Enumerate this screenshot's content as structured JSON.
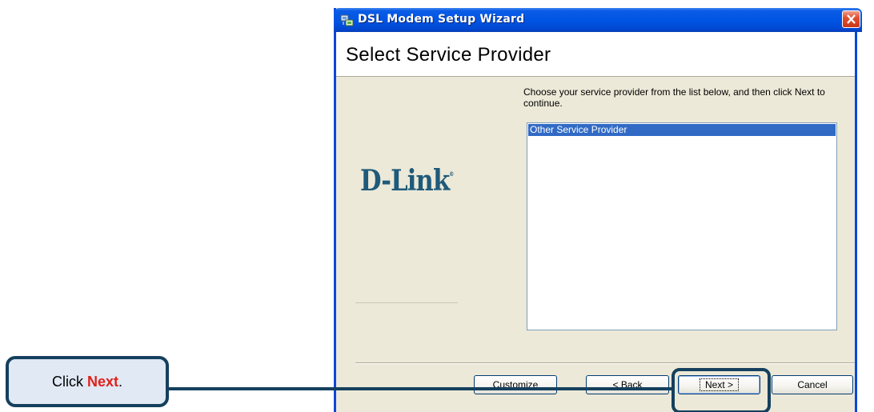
{
  "window": {
    "title": "DSL Modem Setup Wizard",
    "icon": "network-setup-icon",
    "close_icon": "close-icon"
  },
  "header": {
    "title": "Select Service Provider"
  },
  "logo": {
    "text": "D-Link",
    "mark": "®",
    "color": "#1f5a7a"
  },
  "main": {
    "instruction": "Choose your service provider from the list below, and then click Next to continue.",
    "providers": [
      {
        "label": "Other Service Provider",
        "selected": true
      }
    ]
  },
  "buttons": {
    "customize": "Customize",
    "back": "< Back",
    "next": "Next >",
    "cancel": "Cancel"
  },
  "callout": {
    "prefix": "Click ",
    "emphasis": "Next",
    "suffix": ".",
    "emphasis_color": "#e0201a"
  },
  "colors": {
    "titlebar": "#0054e3",
    "selection": "#316ac5",
    "callout_border": "#15405e"
  }
}
